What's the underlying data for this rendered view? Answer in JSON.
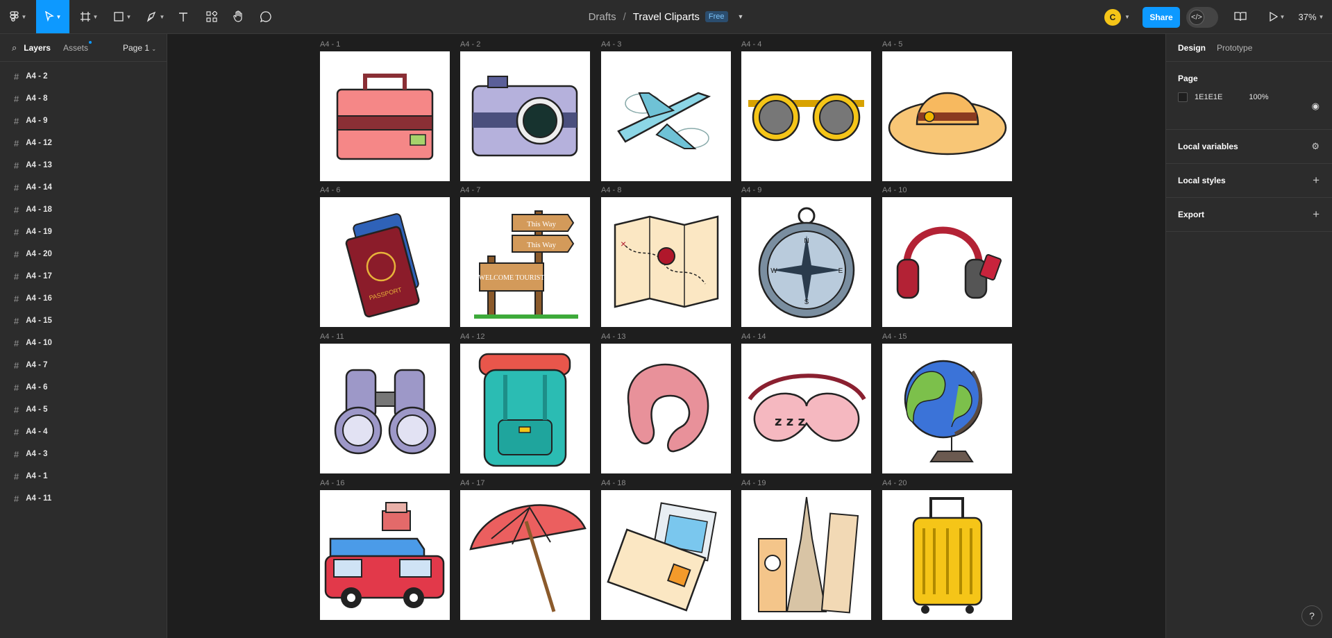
{
  "toolbar": {
    "tools": [
      {
        "name": "main-menu-button",
        "icon": "figma-logo-icon"
      },
      {
        "name": "move-tool-button",
        "icon": "cursor-icon"
      },
      {
        "name": "frame-tool-button",
        "icon": "frame-icon"
      },
      {
        "name": "shape-tool-button",
        "icon": "rectangle-icon"
      },
      {
        "name": "pen-tool-button",
        "icon": "pen-icon"
      },
      {
        "name": "text-tool-button",
        "icon": "text-icon"
      },
      {
        "name": "resources-button",
        "icon": "resources-icon"
      },
      {
        "name": "hand-tool-button",
        "icon": "hand-icon"
      },
      {
        "name": "comment-tool-button",
        "icon": "comment-icon"
      }
    ],
    "breadcrumb_root": "Drafts",
    "breadcrumb_sep": "/",
    "file_title": "Travel Cliparts",
    "plan_badge": "Free",
    "avatar_initial": "C",
    "share_label": "Share",
    "zoom_label": "37%"
  },
  "left_panel": {
    "tab_layers": "Layers",
    "tab_assets": "Assets",
    "page_selector": "Page 1",
    "layers": [
      "A4 - 2",
      "A4 - 8",
      "A4 - 9",
      "A4 - 12",
      "A4 - 13",
      "A4 - 14",
      "A4 - 18",
      "A4 - 19",
      "A4 - 20",
      "A4 - 17",
      "A4 - 16",
      "A4 - 15",
      "A4 - 10",
      "A4 - 7",
      "A4 - 6",
      "A4 - 5",
      "A4 - 4",
      "A4 - 3",
      "A4 - 1",
      "A4 - 11"
    ]
  },
  "right_panel": {
    "tab_design": "Design",
    "tab_prototype": "Prototype",
    "page_heading": "Page",
    "page_color": "1E1E1E",
    "page_opacity": "100%",
    "local_variables": "Local variables",
    "local_styles": "Local styles",
    "export": "Export"
  },
  "canvas": {
    "frames": [
      {
        "label": "A4 - 1",
        "art": "briefcase"
      },
      {
        "label": "A4 - 2",
        "art": "camera"
      },
      {
        "label": "A4 - 3",
        "art": "airplane"
      },
      {
        "label": "A4 - 4",
        "art": "sunglasses"
      },
      {
        "label": "A4 - 5",
        "art": "sun-hat"
      },
      {
        "label": "A4 - 6",
        "art": "passport"
      },
      {
        "label": "A4 - 7",
        "art": "signpost"
      },
      {
        "label": "A4 - 8",
        "art": "map"
      },
      {
        "label": "A4 - 9",
        "art": "compass"
      },
      {
        "label": "A4 - 10",
        "art": "headphones"
      },
      {
        "label": "A4 - 11",
        "art": "binoculars"
      },
      {
        "label": "A4 - 12",
        "art": "backpack"
      },
      {
        "label": "A4 - 13",
        "art": "neck-pillow"
      },
      {
        "label": "A4 - 14",
        "art": "sleep-mask"
      },
      {
        "label": "A4 - 15",
        "art": "globe"
      },
      {
        "label": "A4 - 16",
        "art": "camper-van"
      },
      {
        "label": "A4 - 17",
        "art": "beach-umbrella"
      },
      {
        "label": "A4 - 18",
        "art": "postcard"
      },
      {
        "label": "A4 - 19",
        "art": "landmarks"
      },
      {
        "label": "A4 - 20",
        "art": "suitcase"
      }
    ],
    "art_text": {
      "sign_1": "This Way",
      "sign_2": "This Way",
      "sign_3": "WELCOME TOURIST",
      "passport": "PASSPORT",
      "compass_n": "N",
      "compass_s": "S",
      "compass_e": "E",
      "compass_w": "W"
    }
  },
  "help_label": "?"
}
